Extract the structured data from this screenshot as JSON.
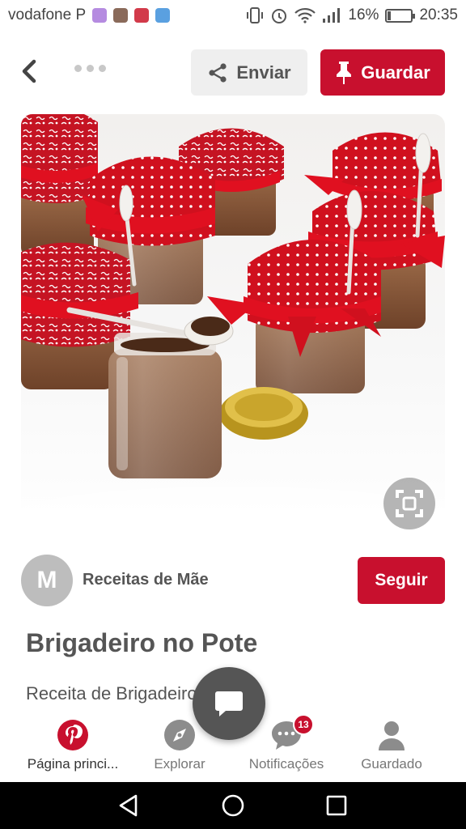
{
  "status_bar": {
    "carrier": "vodafone P",
    "battery": "16%",
    "time": "20:35",
    "icons": [
      "vibrate-icon",
      "alarm-icon",
      "wifi-icon",
      "signal-icon",
      "battery-icon"
    ]
  },
  "toolbar": {
    "back_icon": "back-arrow-icon",
    "more_icon": "more-dots-icon",
    "send_label": "Enviar",
    "save_label": "Guardar"
  },
  "pin": {
    "image_icon": "visual-search-icon",
    "author": {
      "initial": "M",
      "name": "Receitas de Mãe",
      "follow_label": "Seguir"
    },
    "title": "Brigadeiro no Pote",
    "description": "Receita de Brigadeiro no Pote"
  },
  "bottom_nav": [
    {
      "label": "Página princi...",
      "icon": "pinterest-icon",
      "active": true
    },
    {
      "label": "Explorar",
      "icon": "compass-icon",
      "active": false
    },
    {
      "label": "Notificações",
      "icon": "chat-bubble-icon",
      "badge": "13",
      "active": false
    },
    {
      "label": "Guardado",
      "icon": "person-icon",
      "active": false
    }
  ],
  "colors": {
    "brand_red": "#c8102e",
    "text_gray": "#555555"
  }
}
